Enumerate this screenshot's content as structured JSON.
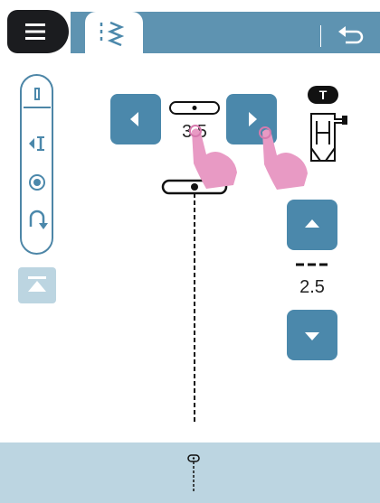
{
  "header": {
    "menu_icon": "hamburger-menu-icon",
    "active_tab_icon": "zigzag-stitch-icon",
    "undo_icon": "undo-icon"
  },
  "left_toolbar": {
    "items": [
      {
        "icon": "needle-position-icon"
      },
      {
        "icon": "left-align-icon"
      },
      {
        "icon": "single-stitch-icon"
      },
      {
        "icon": "reverse-stitch-icon"
      }
    ],
    "mirror_icon": "mirror-flip-icon"
  },
  "stitch_width": {
    "value": "3.5",
    "left_icon": "arrow-left-icon",
    "right_icon": "arrow-right-icon"
  },
  "stitch_length": {
    "value": "2.5",
    "up_icon": "arrow-up-icon",
    "down_icon": "arrow-down-icon"
  },
  "presser_foot": {
    "badge": "T",
    "icon": "presser-foot-icon"
  },
  "colors": {
    "header_blue": "#5e93b1",
    "button_blue": "#4b88ab",
    "light_blue": "#bcd5e1",
    "dark": "#1b1c1f",
    "hand_pink": "#e89ac4"
  }
}
